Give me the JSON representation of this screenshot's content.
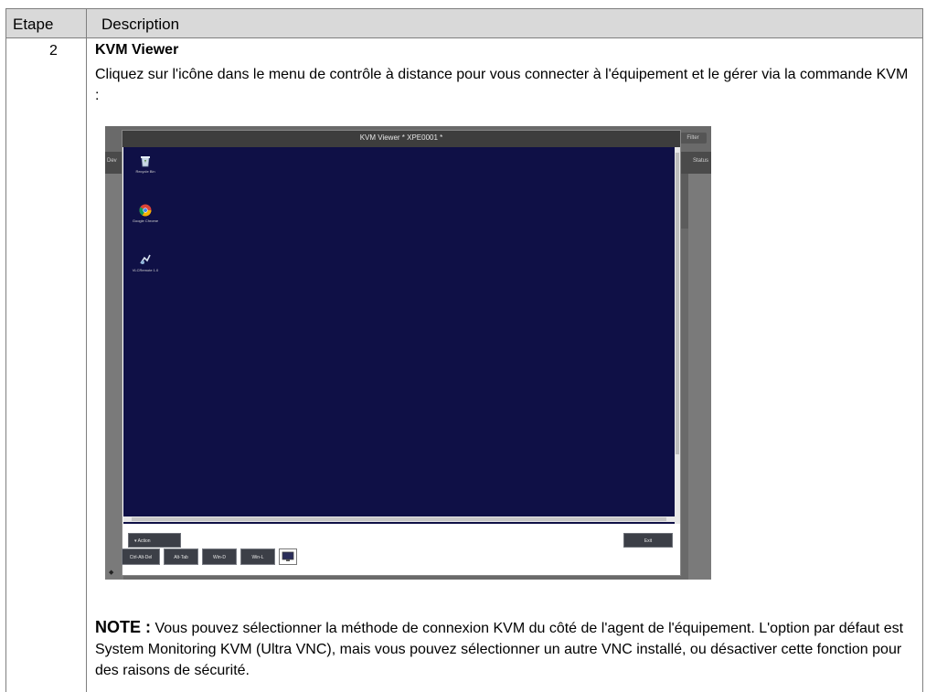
{
  "table": {
    "header": {
      "col1": "Etape",
      "col2": "Description"
    },
    "row": {
      "step": "2",
      "title": "KVM Viewer",
      "text": "Cliquez sur l'icône dans le menu de contrôle à distance pour vous connecter à l'équipement et le gérer via la commande KVM :",
      "note_label": "NOTE :",
      "note_text": " Vous pouvez sélectionner la méthode de connexion KVM du côté de l'agent de l'équipement. L'option par défaut est System Monitoring KVM (Ultra VNC), mais vous pouvez sélectionner un autre VNC installé, ou désactiver cette fonction pour des raisons de sécurité."
    }
  },
  "kvm_viewer": {
    "window_title": "KVM Viewer * XPE0001 *",
    "desktop_icons": [
      {
        "label": "Recycle Bin",
        "icon": "recycle-bin-icon"
      },
      {
        "label": "Google Chrome",
        "icon": "chrome-icon"
      },
      {
        "label": "VLCRemote 1.0",
        "icon": "app-icon"
      }
    ],
    "action_label": "Action",
    "exit_label": "Exit",
    "shortcuts": [
      "Ctrl-Alt-Del",
      "Alt-Tab",
      "Win-D",
      "Win-L"
    ],
    "bg_left_label": "Dev",
    "bg_right_label": "Status",
    "bg_top_right_label": "Filter",
    "colors": {
      "desktop": "#0f1046",
      "titlebar": "#3d3d3d",
      "header_bg": "#d9d9d9"
    }
  }
}
